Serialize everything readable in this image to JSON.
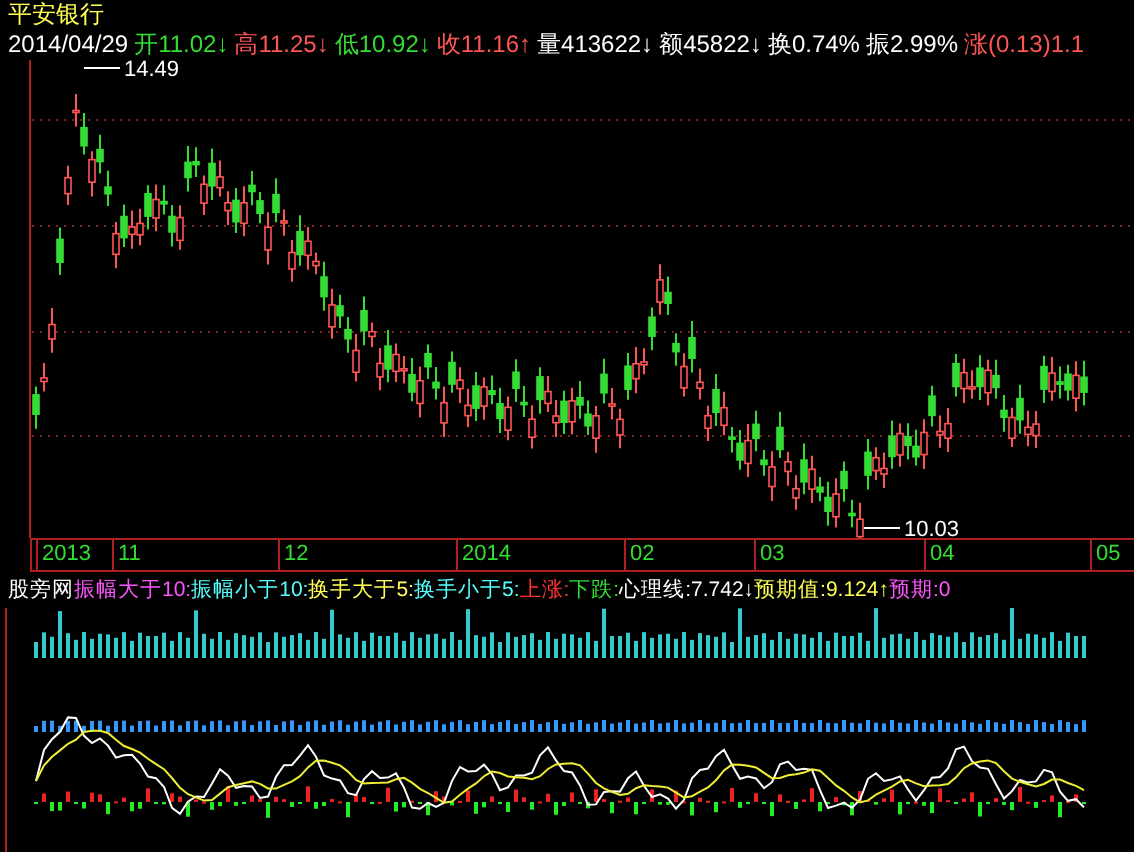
{
  "stock_name": "平安银行",
  "quote": {
    "date": "2014/04/29",
    "fields": [
      {
        "label": "开",
        "value": "11.02",
        "arrow": "↓",
        "color": "#33dd33"
      },
      {
        "label": "高",
        "value": "11.25",
        "arrow": "↓",
        "color": "#ff5555"
      },
      {
        "label": "低",
        "value": "10.92",
        "arrow": "↓",
        "color": "#33dd33"
      },
      {
        "label": "收",
        "value": "11.16",
        "arrow": "↑",
        "color": "#ff5555"
      },
      {
        "label": "量",
        "value": "413622",
        "arrow": "↓",
        "color": "#ffffff"
      },
      {
        "label": "额",
        "value": "45822",
        "arrow": "↓",
        "color": "#ffffff"
      },
      {
        "label": "换",
        "value": "0.74%",
        "color": "#ffffff"
      },
      {
        "label": "振",
        "value": "2.99%",
        "color": "#ffffff"
      },
      {
        "label": "涨",
        "value": "(0.13)1.1",
        "color": "#ff5555"
      }
    ]
  },
  "price_chart": {
    "high_label": "14.49",
    "low_label": "10.03"
  },
  "date_axis": [
    "2013",
    "11",
    "12",
    "2014",
    "02",
    "03",
    "04",
    "05"
  ],
  "legend": [
    {
      "text": "股旁网",
      "color": "#ffffff"
    },
    {
      "text": "振幅大于10:",
      "color": "#ff55ff"
    },
    {
      "text": "振幅小于10:",
      "color": "#55ffff"
    },
    {
      "text": "换手大于5:",
      "color": "#ffff55"
    },
    {
      "text": "换手小于5:",
      "color": "#55ffff"
    },
    {
      "text": "上涨:",
      "color": "#ff3333"
    },
    {
      "text": "下跌:",
      "color": "#33dd33"
    },
    {
      "text": "心理线:7.742↓",
      "color": "#ffffff"
    },
    {
      "text": "预期值:9.124↑",
      "color": "#ffff55"
    },
    {
      "text": "预期:0",
      "color": "#ff55ff"
    }
  ]
}
